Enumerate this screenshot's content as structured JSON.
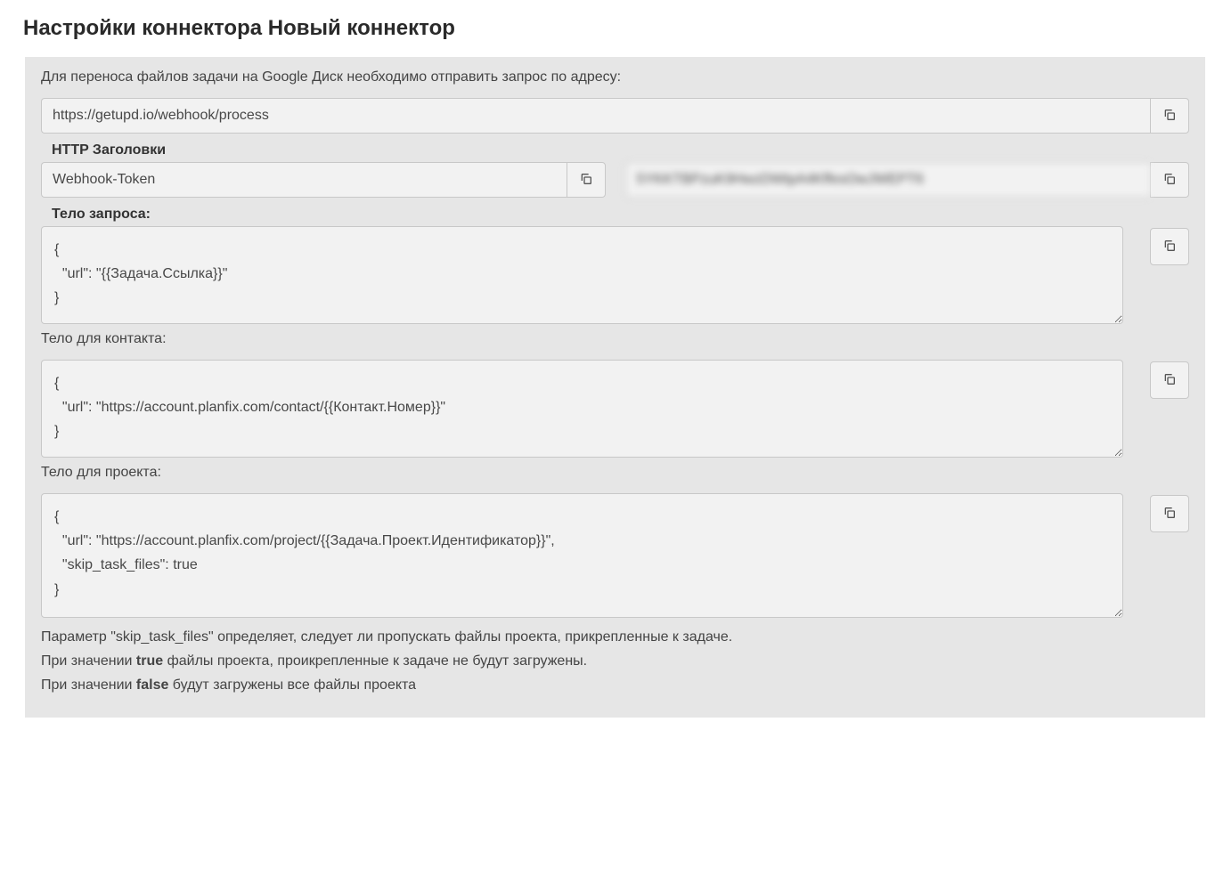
{
  "page_title": "Настройки коннектора Новый коннектор",
  "intro_text": "Для переноса файлов задачи на Google Диск необходимо отправить запрос по адресу:",
  "webhook_url": "https://getupd.io/webhook/process",
  "headers_label": "HTTP Заголовки",
  "header_name": "Webhook-Token",
  "header_value": "5YKKTBPzuK9HwzDWtpA4KffesOwJWEPT6",
  "body_label": "Тело запроса:",
  "body_task": "{\n  \"url\": \"{{Задача.Ссылка}}\"\n}",
  "contact_label": "Тело для контакта:",
  "body_contact": "{\n  \"url\": \"https://account.planfix.com/contact/{{Контакт.Номер}}\"\n}",
  "project_label": "Тело для проекта:",
  "body_project": "{\n  \"url\": \"https://account.planfix.com/project/{{Задача.Проект.Идентификатор}}\",\n  \"skip_task_files\": true\n}",
  "footnote": {
    "line1": "Параметр \"skip_task_files\" определяет, следует ли пропускать файлы проекта, прикрепленные к задаче.",
    "line2_before": "При значении ",
    "line2_bold": "true",
    "line2_after": " файлы проекта, проикрепленные к задаче не будут загружены.",
    "line3_before": "При значении ",
    "line3_bold": "false",
    "line3_after": " будут загружены все файлы проекта"
  }
}
